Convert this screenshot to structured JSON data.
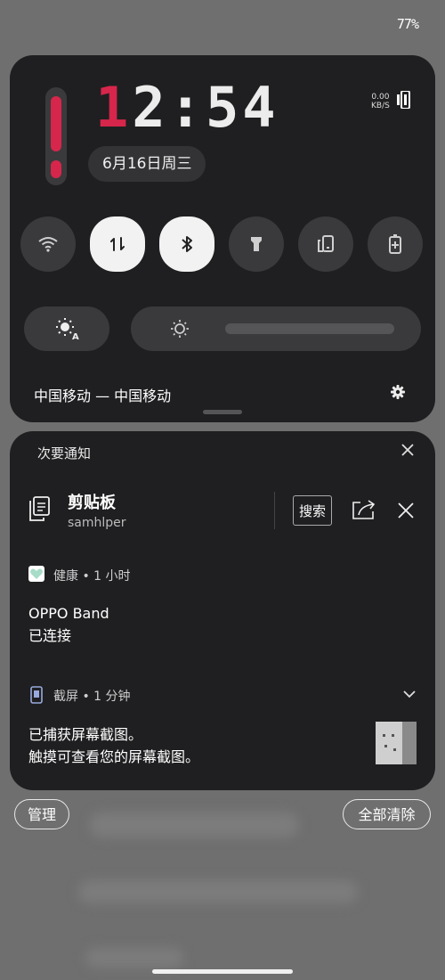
{
  "status_bar": {
    "battery": "77%"
  },
  "quick_settings": {
    "clock": {
      "first_digit": "1",
      "rest": "2:54"
    },
    "date": "6月16日周三",
    "net_speed": {
      "value": "0.00",
      "unit": "KB/S"
    },
    "tiles": [
      {
        "name": "wifi",
        "active": false
      },
      {
        "name": "mobile-data",
        "active": true
      },
      {
        "name": "bluetooth",
        "active": true
      },
      {
        "name": "flashlight",
        "active": false
      },
      {
        "name": "screen-cast",
        "active": false
      },
      {
        "name": "battery-saver",
        "active": false
      }
    ],
    "brightness_level": 0.0,
    "carrier": "中国移动 — 中国移动"
  },
  "notifications": {
    "title": "次要通知",
    "clipboard": {
      "title": "剪贴板",
      "subtitle": "samhlper",
      "search_label": "搜索"
    },
    "health": {
      "app": "健康",
      "time": "1 小时",
      "line1": "OPPO Band",
      "line2": "已连接"
    },
    "screenshot": {
      "app": "截屏",
      "time": "1 分钟",
      "line1": "已捕获屏幕截图。",
      "line2": "触摸可查看您的屏幕截图。"
    }
  },
  "actions": {
    "manage": "管理",
    "clear_all": "全部清除"
  },
  "colors": {
    "accent": "#d7264b",
    "panel": "#1f1f21",
    "tile": "#3a3a3d"
  }
}
